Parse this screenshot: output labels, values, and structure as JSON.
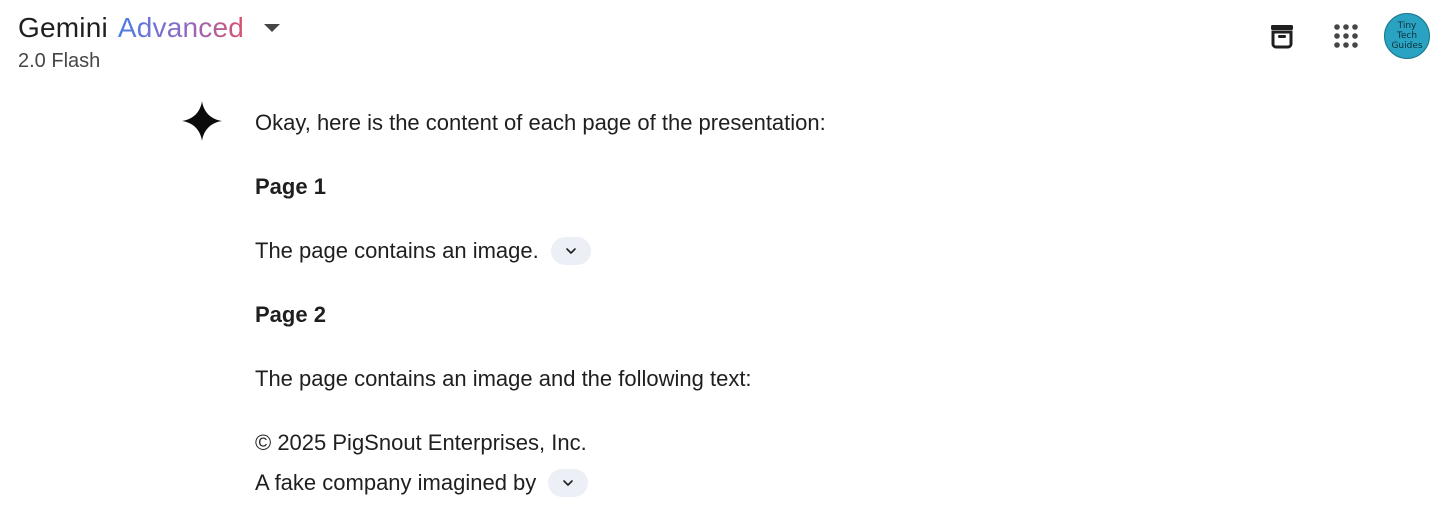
{
  "header": {
    "model_name": "Gemini",
    "model_tier": "Advanced",
    "model_version": "2.0 Flash",
    "icons": [
      "archive-icon",
      "apps-grid-icon"
    ],
    "avatar_text": [
      "Tiny",
      "Tech",
      "Guides"
    ],
    "avatar_color": "#2aa3c3",
    "tier_gradient": [
      "#4b7ee8",
      "#9168c0",
      "#d6546e"
    ]
  },
  "response": {
    "intro": "Okay, here is the content of each page of the presentation:",
    "page1_heading": "Page 1",
    "page1_text": "The page contains an image.",
    "page2_heading": "Page 2",
    "page2_text": "The page contains an image and the following text:",
    "copyright_line": "© 2025 PigSnout Enterprises, Inc.",
    "fake_company_line": "A fake company imagined by"
  }
}
